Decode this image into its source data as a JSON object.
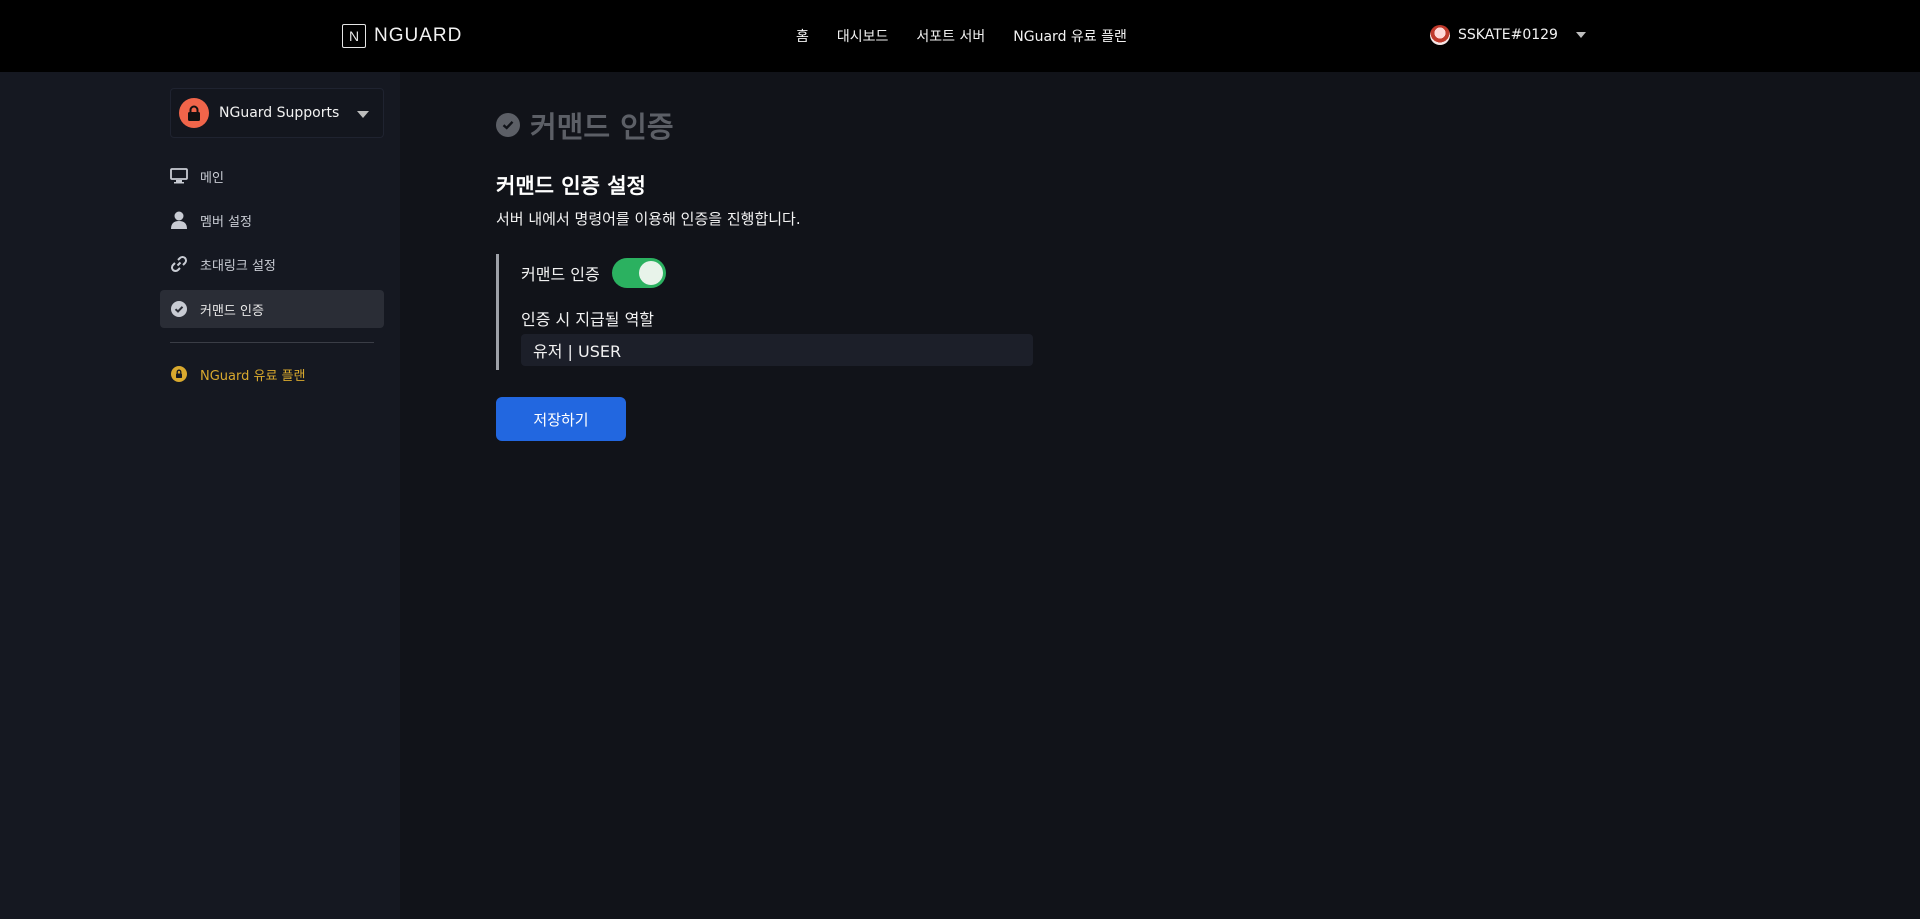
{
  "brand": {
    "logo_letter": "N",
    "name": "NGUARD"
  },
  "topnav": {
    "items": [
      "홈",
      "대시보드",
      "서포트 서버",
      "NGuard 유료 플랜"
    ]
  },
  "user": {
    "name": "SSKATE#0129",
    "avatar_icon": "user-avatar"
  },
  "sidebar": {
    "server": {
      "name": "NGuard Supports",
      "icon": "lock-icon",
      "color": "#f0654a"
    },
    "items": [
      {
        "label": "메인",
        "icon": "monitor-icon"
      },
      {
        "label": "멤버 설정",
        "icon": "user-icon"
      },
      {
        "label": "초대링크 설정",
        "icon": "link-icon"
      },
      {
        "label": "커맨드 인증",
        "icon": "check-circle-icon",
        "active": true
      }
    ],
    "premium": {
      "label": "NGuard 유료 플랜",
      "icon": "lock-icon",
      "color": "#d9a92e"
    }
  },
  "main": {
    "page_title": "커맨드 인증",
    "section_title": "커맨드 인증 설정",
    "section_desc": "서버 내에서 명령어를 이용해 인증을 진행합니다.",
    "toggle": {
      "label": "커맨드 인증",
      "on": true,
      "color": "#2bb160"
    },
    "role": {
      "label": "인증 시 지급될 역할",
      "value": "유저 | USER"
    },
    "save_label": "저장하기",
    "accent": "#2267e0"
  }
}
